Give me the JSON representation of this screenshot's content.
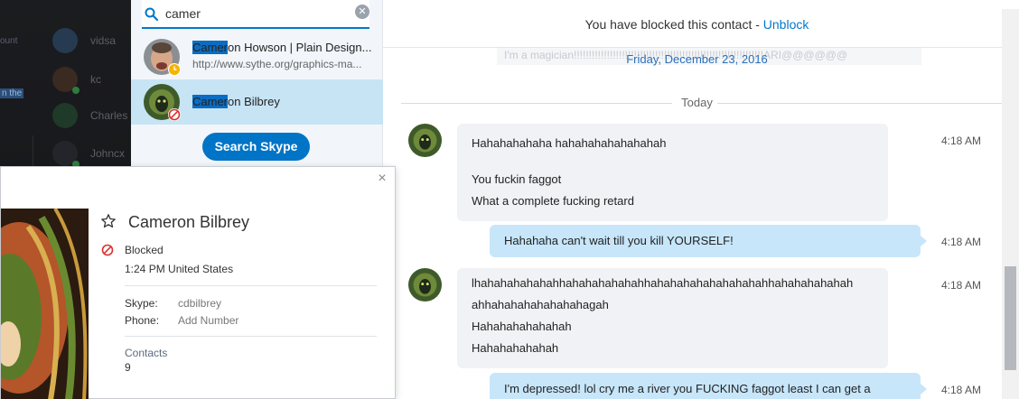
{
  "sidebar": {
    "items": [
      {
        "name": "vidsa",
        "fragment": "ount"
      },
      {
        "name": "kc",
        "fragment": ""
      },
      {
        "name": "Charles",
        "fragment": "n the"
      },
      {
        "name": "Johncx",
        "fragment": ""
      }
    ]
  },
  "search": {
    "query": "camer",
    "results": [
      {
        "highlight": "Camer",
        "name_rest": "on Howson | Plain Design...",
        "subtitle": "http://www.sythe.org/graphics-ma...",
        "status": "away"
      },
      {
        "highlight": "Camer",
        "name_rest": "on Bilbrey",
        "subtitle": "",
        "status": "blocked"
      }
    ],
    "search_skype_label": "Search Skype"
  },
  "chat": {
    "blocked_banner_text": "You have blocked this contact - ",
    "unblock_label": "Unblock",
    "ghost_message": "I'm a magician!!!!!!!!!!!!!!!!!!!!!!!!!!!!!!!!!!!!!!!!!!!!!!!!!!!!!!!!!!!!!!!ARI@@@@@@",
    "old_date": "Friday, December 23, 2016",
    "today_label": "Today",
    "messages": [
      {
        "direction": "in",
        "time": "4:18 AM",
        "lines": [
          "Hahahahahaha hahahahahahahahah",
          "",
          "You fuckin faggot",
          "What a complete fucking retard"
        ]
      },
      {
        "direction": "out",
        "time": "4:18 AM",
        "lines": [
          "Hahahaha can't wait till you kill YOURSELF!"
        ]
      },
      {
        "direction": "in",
        "time": "4:18 AM",
        "lines": [
          "lhahahahahahahhahahahahahahhahahahahahahahahahhahahahahahah",
          "ahhahahahahahahahagah",
          "Hahahahahahahah",
          "Hahahahahahah"
        ]
      },
      {
        "direction": "out",
        "time": "4:18 AM",
        "lines": [
          "I'm depressed! lol cry me a river you FUCKING faggot least I can get a"
        ]
      }
    ]
  },
  "profile": {
    "close_label": "×",
    "name": "Cameron Bilbrey",
    "status": "Blocked",
    "local_time": "1:24 PM United States",
    "skype_label": "Skype:",
    "skype_value": "cdbilbrey",
    "phone_label": "Phone:",
    "phone_value": "Add Number",
    "contacts_label": "Contacts",
    "contacts_count": "9"
  },
  "colors": {
    "accent": "#0078ca",
    "selected_row": "#c7e4f5",
    "outgoing_bubble": "#c7e6fa",
    "incoming_bubble": "#f0f2f5",
    "blocked_red": "#d9302f",
    "away_yellow": "#f4b400"
  },
  "icons": {
    "search": "search-icon",
    "clear": "clear-icon",
    "star": "star-icon",
    "blocked": "blocked-icon",
    "close": "close-icon",
    "away": "away-clock-icon"
  }
}
